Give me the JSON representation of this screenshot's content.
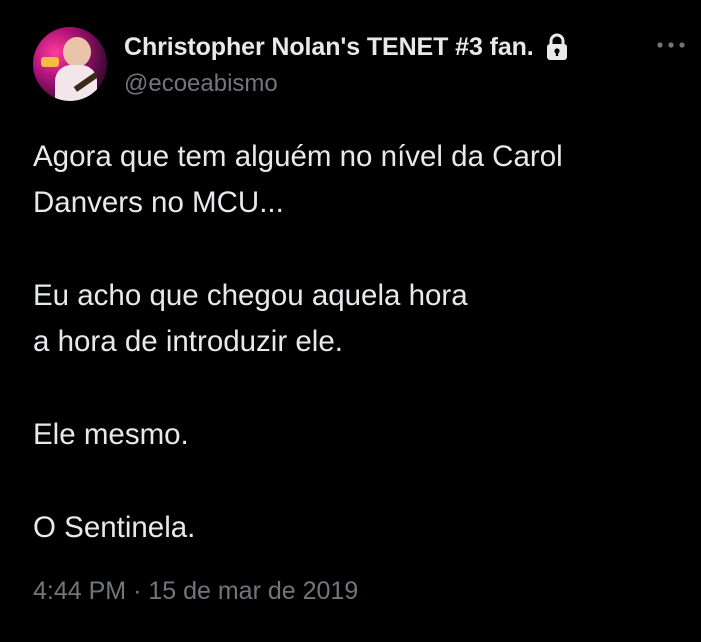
{
  "author": {
    "display_name": "Christopher Nolan's TENET #3 fan.",
    "handle": "@ecoeabismo",
    "protected": true
  },
  "tweet": {
    "paragraphs": [
      [
        "Agora que tem alguém no nível da Carol",
        "Danvers no MCU..."
      ],
      [
        "Eu acho que chegou aquela hora",
        "a hora de introduzir ele."
      ],
      [
        "Ele mesmo."
      ],
      [
        "O Sentinela."
      ]
    ]
  },
  "meta": {
    "time": "4:44 PM",
    "separator": "·",
    "date": "15 de mar de 2019"
  },
  "icons": {
    "lock": "lock-icon",
    "more": "more-options-icon"
  },
  "colors": {
    "background": "#000000",
    "primary_text": "#e7e9ea",
    "secondary_text": "#71767b"
  }
}
